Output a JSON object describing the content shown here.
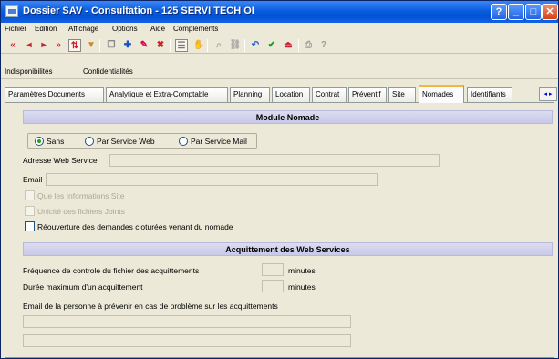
{
  "window": {
    "title": "Dossier SAV - Consultation - 125 SERVI TECH OI",
    "buttons": {
      "help": "?",
      "minimize": "_",
      "maximize": "□",
      "close": "✕"
    }
  },
  "menu": [
    "Fichier",
    "Edition",
    "Affichage",
    "Options",
    "Aide",
    "Compléments"
  ],
  "toolbar_icons": [
    "first-icon",
    "prev-icon",
    "next-icon",
    "last-icon",
    "sort-icon",
    "filter-icon",
    "copy-icon",
    "add-icon",
    "edit-icon",
    "delete-icon",
    "list-icon",
    "hand-icon",
    "search-icon",
    "links-icon",
    "undo-icon",
    "validate-icon",
    "exit-icon",
    "print-icon",
    "help-icon"
  ],
  "subtabs": [
    "Indisponibilités",
    "Confidentialités"
  ],
  "tabs": [
    "Paramètres Documents",
    "Analytique et Extra-Comptable",
    "Planning",
    "Location",
    "Contrat",
    "Préventif",
    "Site",
    "Nomades",
    "Identifiants"
  ],
  "active_tab": "Nomades",
  "module_nomade": {
    "header": "Module Nomade",
    "radios": [
      {
        "label": "Sans",
        "checked": true
      },
      {
        "label": "Par Service Web",
        "checked": false
      },
      {
        "label": "Par Service Mail",
        "checked": false
      }
    ],
    "web_service_label": "Adresse Web Service",
    "web_service_value": "",
    "email_label": "Email",
    "email_value": "",
    "checkboxes": [
      {
        "label": "Que les Informations Site",
        "checked": false,
        "disabled": true
      },
      {
        "label": "Unicité des fichiers Joints",
        "checked": false,
        "disabled": true
      },
      {
        "label": "Réouverture des demandes cloturées venant du nomade",
        "checked": false,
        "disabled": false
      }
    ]
  },
  "acquittement": {
    "header": "Acquittement des Web Services",
    "frequence_label": "Fréquence de controle du fichier des acquittements",
    "frequence_value": "",
    "frequence_unit": "minutes",
    "duree_label": "Durée maximum d'un acquittement",
    "duree_value": "",
    "duree_unit": "minutes",
    "email_label": "Email de la personne à prévenir en cas de problème sur les acquittements",
    "email_value_1": "",
    "email_value_2": ""
  },
  "tab_scroll": "◂ ▸"
}
